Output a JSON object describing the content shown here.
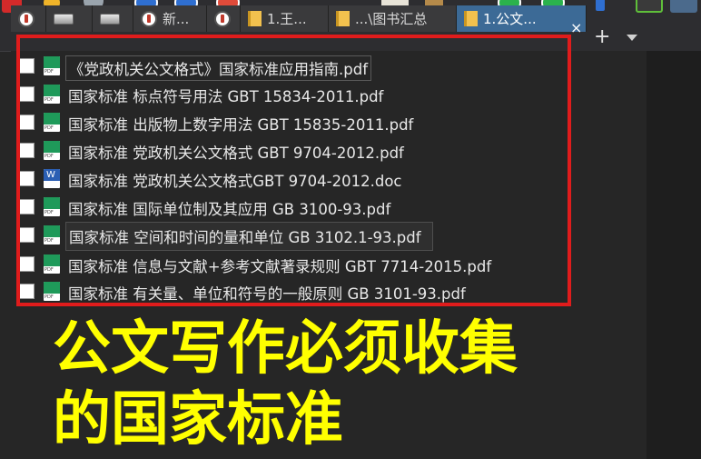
{
  "tabs": [
    {
      "label": "",
      "icon": "info-icon"
    },
    {
      "label": "",
      "icon": "drive-icon"
    },
    {
      "label": "",
      "icon": "drive-icon"
    },
    {
      "label": "新...",
      "icon": "info-icon"
    },
    {
      "label": "",
      "icon": "info-icon"
    },
    {
      "label": "1.王...",
      "icon": "folder-icon"
    },
    {
      "label": "...\\图书汇总",
      "icon": "folder-icon"
    },
    {
      "label": "1.公文...",
      "icon": "folder-icon",
      "active": true
    }
  ],
  "tab_close_glyph": "×",
  "tab_add_glyph": "+",
  "files": [
    {
      "name": "《党政机关公文格式》国家标准应用指南.pdf",
      "type": "pdf"
    },
    {
      "name": "国家标准 标点符号用法 GBT 15834-2011.pdf",
      "type": "pdf"
    },
    {
      "name": "国家标准 出版物上数字用法 GBT 15835-2011.pdf",
      "type": "pdf"
    },
    {
      "name": "国家标准 党政机关公文格式 GBT 9704-2012.pdf",
      "type": "pdf"
    },
    {
      "name": "国家标准 党政机关公文格式GBT 9704-2012.doc",
      "type": "doc"
    },
    {
      "name": "国家标准 国际单位制及其应用 GB 3100-93.pdf",
      "type": "pdf"
    },
    {
      "name": "国家标准 空间和时间的量和单位 GB 3102.1-93.pdf",
      "type": "pdf"
    },
    {
      "name": "国家标准 信息与文献+参考文献著录规则 GBT 7714-2015.pdf",
      "type": "pdf"
    },
    {
      "name": "国家标准 有关量、单位和符号的一般原则 GB 3101-93.pdf",
      "type": "pdf"
    }
  ],
  "file_icon_tags": {
    "pdf": "PDF",
    "doc": "W"
  },
  "overlay": {
    "line1": "公文写作必须收集",
    "line2": "的国家标准"
  },
  "colors": {
    "highlight_box": "#e01c1c",
    "overlay_text": "#ffff00",
    "pdf_icon": "#1f9a5a",
    "doc_icon": "#2b5fb4",
    "active_tab": "#3c6a96"
  }
}
